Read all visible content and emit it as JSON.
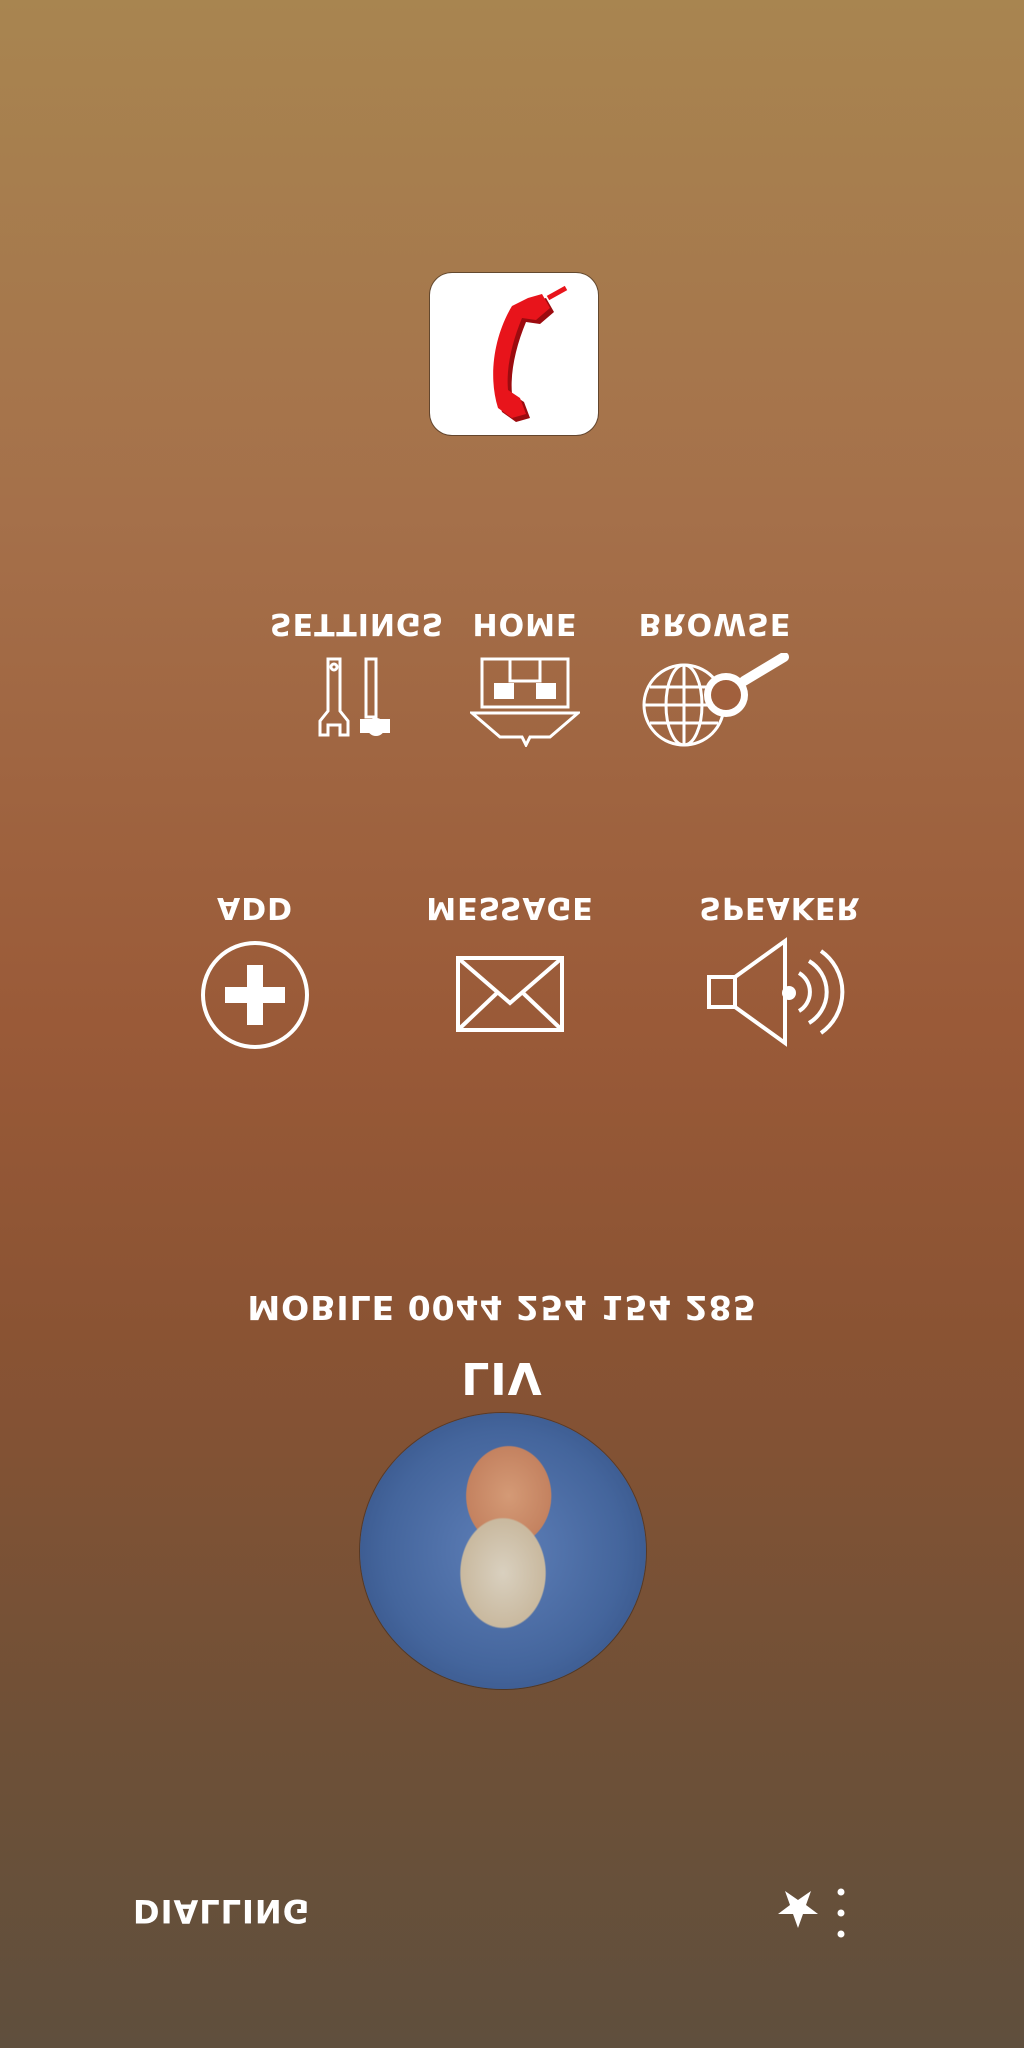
{
  "call_screen": {
    "status": "DIALLING",
    "caller": {
      "name": "LIV",
      "number": "MOBILE 0044 254 154 285"
    },
    "controls_row1": {
      "settings": "SETTINGS",
      "home": "HOME",
      "browse": "BROWSE"
    },
    "controls_row2": {
      "add": "ADD",
      "message": "MESSAGE",
      "speaker": "SPEAKER"
    },
    "icons": {
      "end_call": "phone-handset-icon",
      "settings": "tools-icon",
      "home": "home-icon",
      "browse": "globe-search-icon",
      "add": "plus-circle-icon",
      "message": "envelope-icon",
      "speaker": "speaker-icon",
      "favorite": "star-icon",
      "more": "more-vertical-icon"
    },
    "colors": {
      "end_call_red": "#e8141b",
      "text": "#ffffff"
    }
  }
}
